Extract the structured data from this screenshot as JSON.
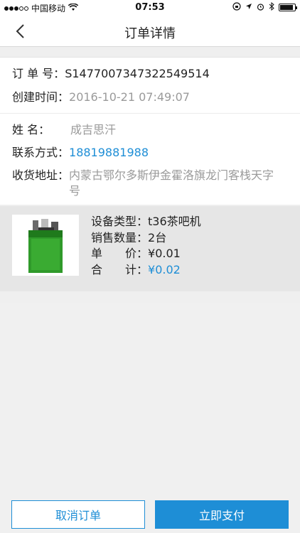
{
  "status_bar": {
    "carrier": "中国移动",
    "time": "07:53",
    "battery_level": 0.9
  },
  "nav": {
    "title": "订单详情",
    "back_icon": "chevron-left-icon"
  },
  "order": {
    "number_label": "订 单 号：",
    "number_value": "S1477007347322549514",
    "created_label": "创建时间：",
    "created_value": "2016-10-21 07:49:07"
  },
  "address": {
    "name_label": "姓 名：",
    "name_value": "成吉思汗",
    "phone_label": "联系方式：",
    "phone_value": "18819881988",
    "address_label": "收货地址：",
    "address_value": "内蒙古鄂尔多斯伊金霍洛旗龙门客栈天字号"
  },
  "product": {
    "type_label": "设备类型：",
    "type_value": "t36茶吧机",
    "qty_label": "销售数量：",
    "qty_value": "2台",
    "price_label": "单　　价：",
    "price_value": "¥0.01",
    "total_label": "合　　计：",
    "total_value": "¥0.02"
  },
  "actions": {
    "cancel_label": "取消订单",
    "pay_label": "立即支付"
  },
  "colors": {
    "accent": "#1e8ed6",
    "product_bg": "#e6e6e6",
    "page_bg": "#efefef"
  }
}
